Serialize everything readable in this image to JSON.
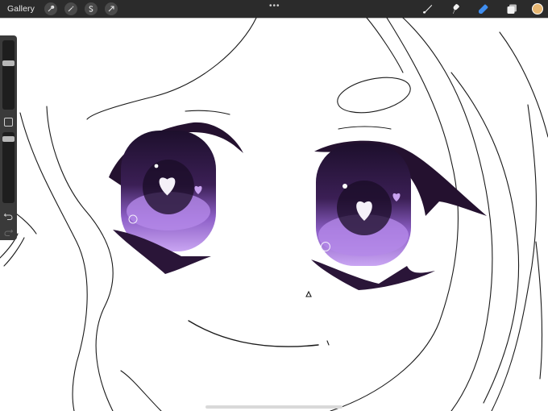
{
  "toolbar": {
    "gallery_label": "Gallery",
    "more_glyph": "•••",
    "left_tools": [
      "wrench-icon",
      "magic-wand-icon",
      "selection-s-icon",
      "transform-arrow-icon"
    ],
    "right_tools": [
      "brush-icon",
      "smudge-icon",
      "eraser-icon",
      "layers-icon"
    ],
    "active_tool": "eraser-icon",
    "current_color": "#e8b873"
  },
  "sidebar": {
    "brush_size_level": 0.32,
    "brush_opacity_level": 0.06,
    "icons": [
      "modify-square-icon",
      "undo-icon",
      "redo-icon"
    ]
  },
  "colors": {
    "toolbar_bg": "#2b2b2b",
    "accent_blue": "#3f8ef0",
    "iris_dark": "#2a1538",
    "iris_light": "#b48ae6"
  }
}
